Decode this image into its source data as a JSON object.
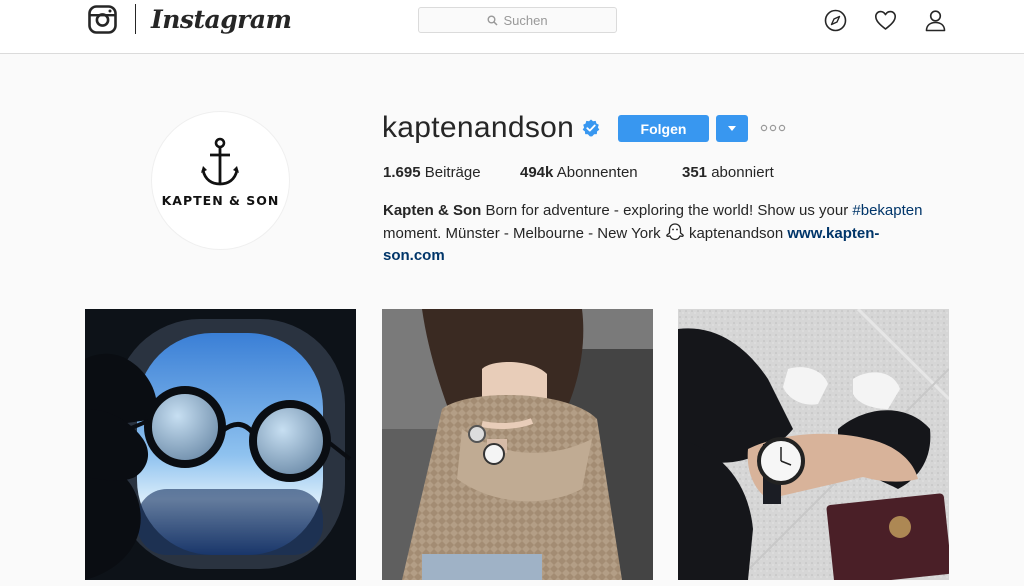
{
  "header": {
    "wordmark": "Instagram",
    "search_placeholder": "Suchen",
    "icons": [
      "instagram-glyph-icon",
      "search-icon",
      "compass-icon",
      "heart-icon",
      "user-icon"
    ]
  },
  "profile": {
    "username": "kaptenandson",
    "verified": true,
    "avatar_text": "KAPTEN & SON",
    "follow_label": "Folgen",
    "accent_color": "#3897f0",
    "verified_color": "#3897f0",
    "link_color": "#003569",
    "stats": {
      "posts_count": "1.695",
      "posts_label": "Beiträge",
      "followers_count": "494k",
      "followers_label": "Abonnenten",
      "following_count": "351",
      "following_label": "abonniert"
    },
    "bio": {
      "name": "Kapten & Son",
      "text_1": "Born for adventure - exploring the world! Show us your",
      "hashtag": "#bekapten",
      "text_2": "moment. Münster - Melbourne - New York",
      "emoji": "ghost-emoji",
      "snapchat": "kaptenandson",
      "link_line_1": "www.kapten-",
      "link_line_2": "son.com"
    }
  },
  "posts": [
    {
      "subject": "sunglasses held against airplane window"
    },
    {
      "subject": "woman in knit sweater wearing watch"
    },
    {
      "subject": "watch on wrist with passport and sneakers"
    }
  ]
}
